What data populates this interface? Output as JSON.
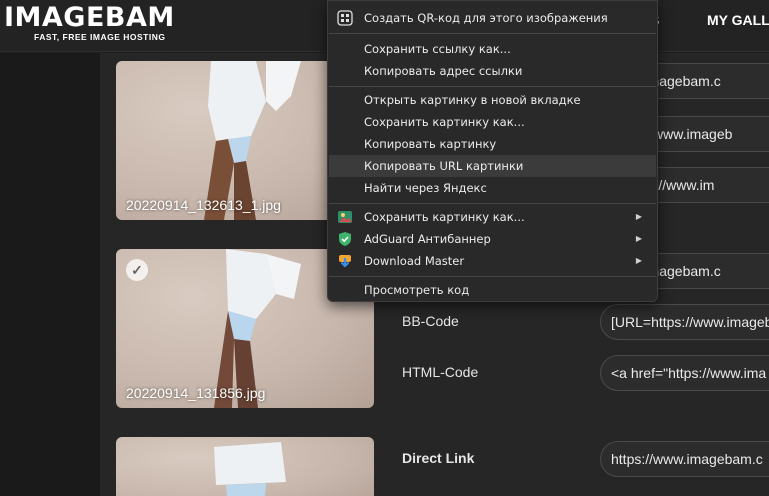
{
  "header": {
    "logo": "IMAGEBAM",
    "tagline": "FAST, FREE IMAGE HOSTING",
    "nav": [
      "S",
      "MY GALLE"
    ]
  },
  "images": [
    {
      "filename": "20220914_132613_1.jpg"
    },
    {
      "filename": "20220914_131856.jpg",
      "selected": true
    },
    {
      "filename": ""
    }
  ],
  "fields_top": {
    "f1": "www.imagebam.c",
    "f2": "https://www.imageb",
    "f3": "=\"https://www.im"
  },
  "fields_mid": {
    "link_value": "www.imagebam.c",
    "bb_label": "BB-Code",
    "bb_value": "[URL=https://www.imageb",
    "html_label": "HTML-Code",
    "html_value": "<a href=\"https://www.ima"
  },
  "fields_bottom": {
    "direct_label": "Direct Link",
    "direct_value": "https://www.imagebam.c"
  },
  "context_menu": {
    "qr": "Создать QR-код для этого изображения",
    "save_link": "Сохранить ссылку как...",
    "copy_link": "Копировать адрес ссылки",
    "open_image": "Открыть картинку в новой вкладке",
    "save_image": "Сохранить картинку как...",
    "copy_image": "Копировать картинку",
    "copy_image_url": "Копировать URL картинки",
    "search_yandex": "Найти через Яндекс",
    "ext_save_image": "Сохранить картинку как...",
    "adguard": "AdGuard Антибаннер",
    "download_master": "Download Master",
    "view_source": "Просмотреть код"
  },
  "colors": {
    "menu_bg": "#292929",
    "highlight": "#3b3b3b",
    "page_bg": "#262626",
    "adguard_green": "#3fb36b"
  }
}
